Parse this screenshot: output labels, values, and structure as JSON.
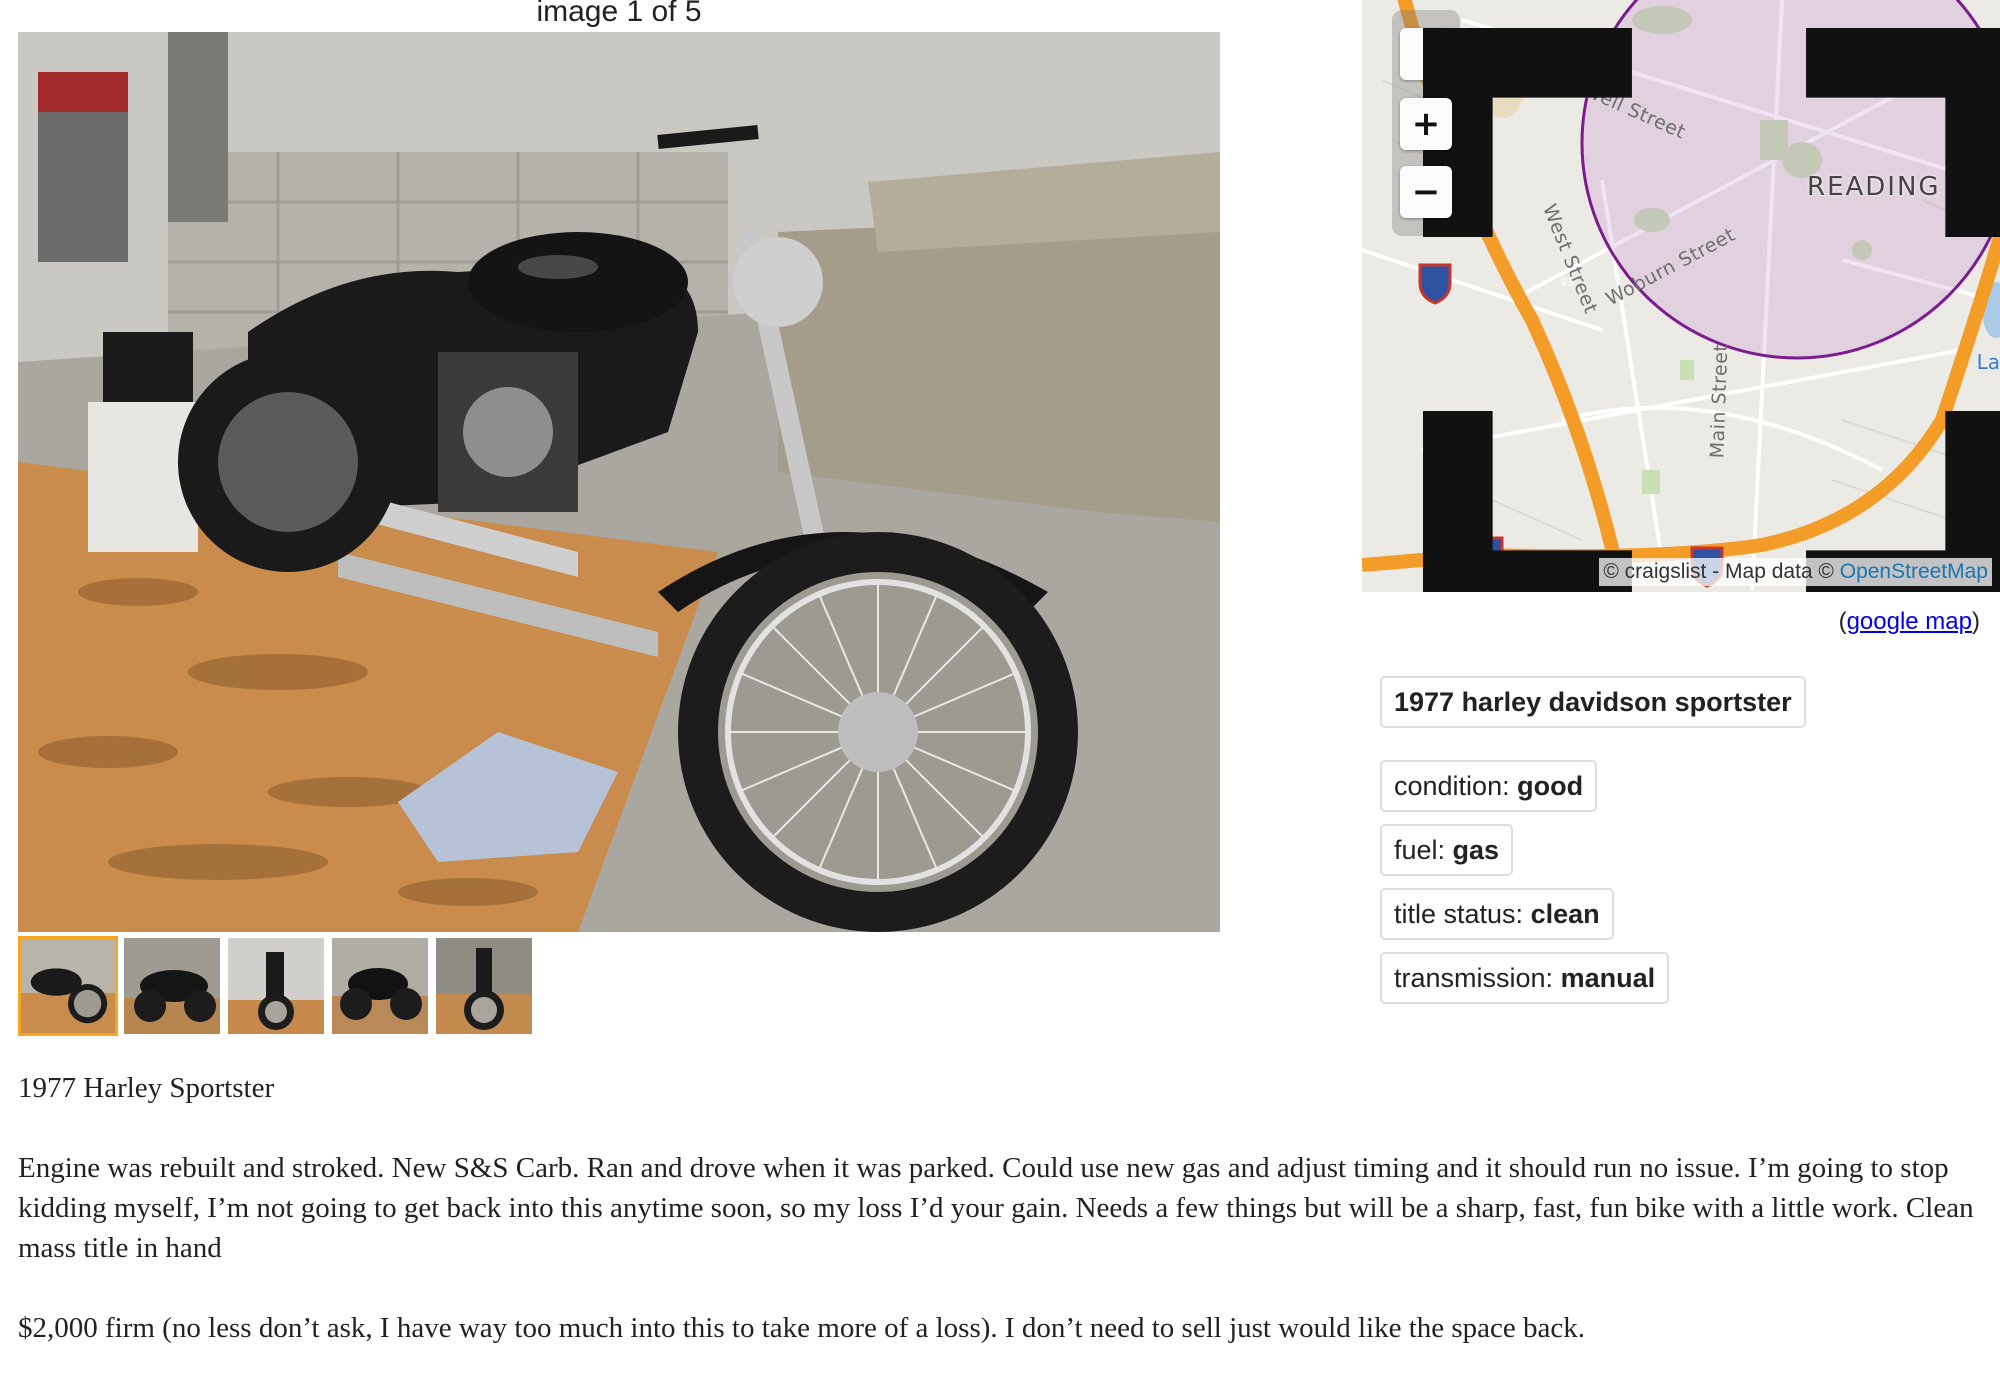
{
  "gallery": {
    "counter": "image 1 of 5",
    "main_image_alt": "",
    "thumbnails": [
      {
        "active": true
      },
      {
        "active": false
      },
      {
        "active": false
      },
      {
        "active": false
      },
      {
        "active": false
      }
    ]
  },
  "map": {
    "controls": {
      "fullscreen": "⛶",
      "zoom_in": "+",
      "zoom_out": "−"
    },
    "city_label": "READING",
    "street_labels": [
      "Lowell Street",
      "Woburn Street",
      "West Street",
      "Main Street"
    ],
    "edge_label": "La",
    "highway_shields": [
      "93",
      "95",
      "95"
    ],
    "attribution_prefix": "© craigslist - Map data © ",
    "attribution_link": "OpenStreetMap",
    "google_map_open": "(",
    "google_map_link": "google map",
    "google_map_close": ")"
  },
  "attributes": {
    "title": "1977 harley davidson sportster",
    "items": [
      {
        "label": "condition: ",
        "value": "good"
      },
      {
        "label": "fuel: ",
        "value": "gas"
      },
      {
        "label": "title status: ",
        "value": "clean"
      },
      {
        "label": "transmission: ",
        "value": "manual"
      }
    ]
  },
  "posting": {
    "heading": "1977 Harley Sportster",
    "paragraph1": "Engine was rebuilt and stroked. New S&S Carb. Ran and drove when it was parked. Could use new gas and adjust timing and it should run no issue. I’m going to stop kidding myself, I’m not going to get back into this anytime soon, so my loss I’d your gain. Needs a few things but will be a sharp, fast, fun bike with a little work. Clean mass title in hand",
    "paragraph2": "$2,000 firm (no less don’t ask, I have way too much into this to take more of a loss). I don’t need to sell just would like the space back."
  }
}
